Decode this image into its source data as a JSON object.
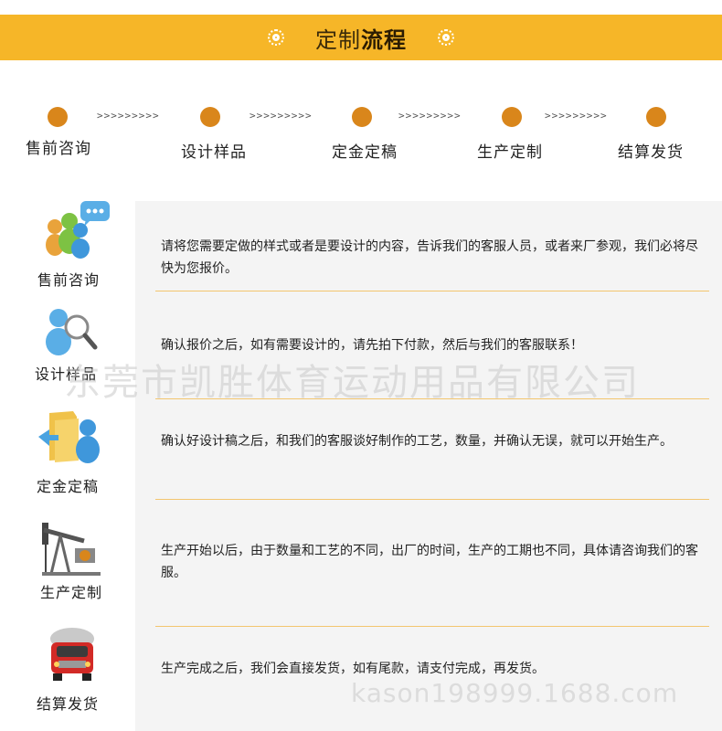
{
  "header": {
    "title_light": "定制",
    "title_bold": "流程"
  },
  "steps": [
    {
      "label": "售前咨询"
    },
    {
      "label": "设计样品"
    },
    {
      "label": "定金定稿"
    },
    {
      "label": "生产定制"
    },
    {
      "label": "结算发货"
    }
  ],
  "arrows": ">>>>>>>>>",
  "rows": [
    {
      "label": "售前咨询",
      "text": "请将您需要定做的样式或者是要设计的内容，告诉我们的客服人员，或者来厂参观，我们必将尽快为您报价。",
      "icon": "chat-people-icon"
    },
    {
      "label": "设计样品",
      "text": "确认报价之后，如有需要设计的，请先拍下付款，然后与我们的客服联系！",
      "icon": "search-person-icon"
    },
    {
      "label": "定金定稿",
      "text": "确认好设计稿之后，和我们的客服谈好制作的工艺，数量，并确认无误，就可以开始生产。",
      "icon": "folder-person-icon"
    },
    {
      "label": "生产定制",
      "text": "生产开始以后，由于数量和工艺的不同，出厂的时间，生产的工期也不同，具体请咨询我们的客服。",
      "icon": "pump-jack-icon"
    },
    {
      "label": "结算发货",
      "text": "生产完成之后，我们会直接发货，如有尾款，请支付完成，再发货。",
      "icon": "truck-icon"
    }
  ],
  "watermark": {
    "company": "东莞市凯胜体育运动用品有限公司",
    "site": "kason198999.1688.com"
  },
  "colors": {
    "banner": "#f6b628",
    "dot": "#d9861b",
    "divider": "#f3c56e",
    "panel": "#f4f4f4"
  }
}
